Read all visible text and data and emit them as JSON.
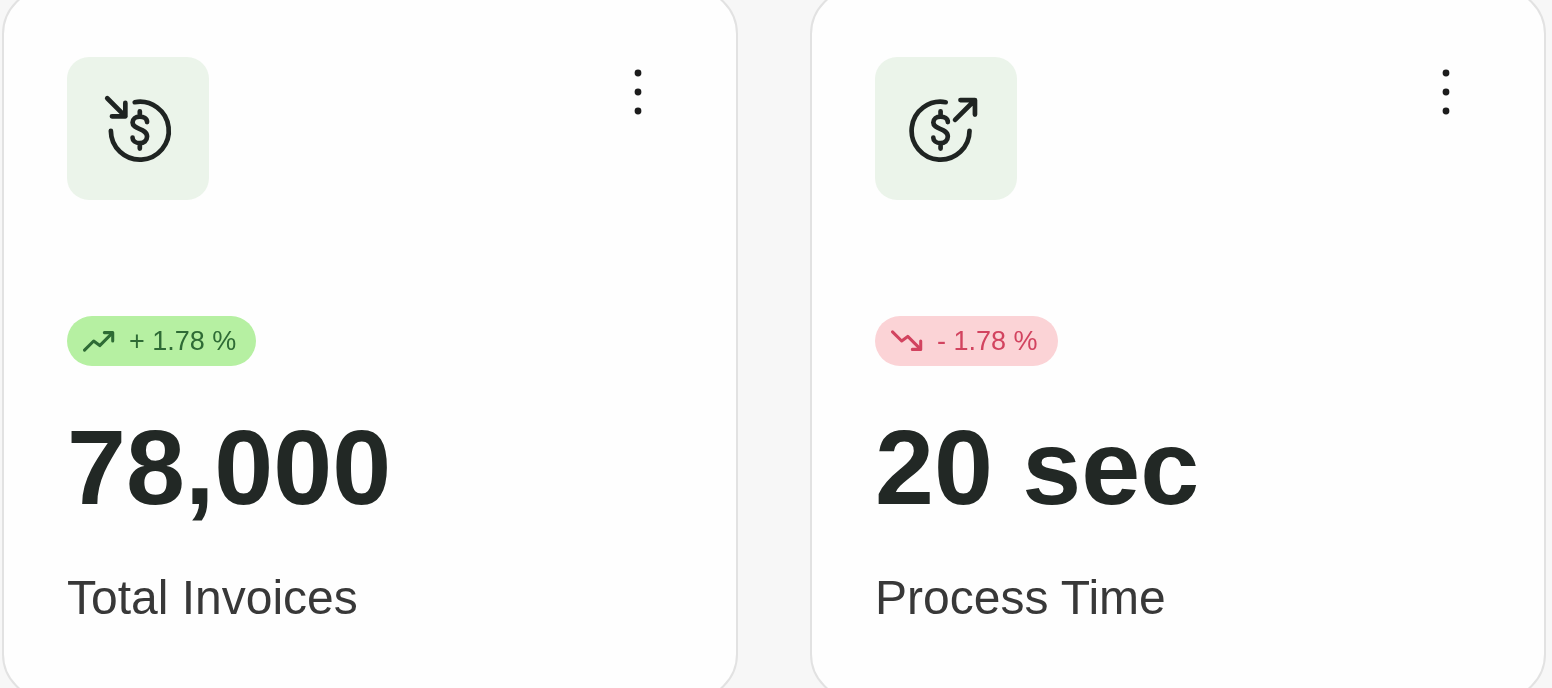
{
  "cards": [
    {
      "kind": "incoming",
      "trend": {
        "kind": "up",
        "text": "+ 1.78 %"
      },
      "value": "78,000",
      "label": "Total Invoices"
    },
    {
      "kind": "outgoing",
      "trend": {
        "kind": "down",
        "text": "- 1.78 %"
      },
      "value": "20 sec",
      "label": "Process Time"
    }
  ]
}
